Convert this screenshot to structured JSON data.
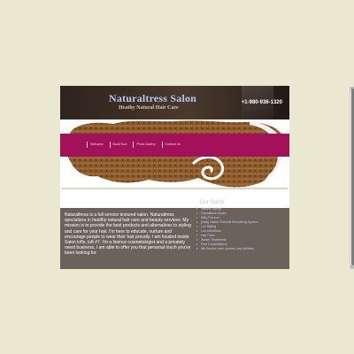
{
  "header": {
    "title": "Naturaltress Salon",
    "tagline": "Heathy Natural Hair Care",
    "phone": "+1-980-936-1320"
  },
  "nav": {
    "items": [
      {
        "label": "Welcome"
      },
      {
        "label": "Book Now"
      },
      {
        "label": "Photo Gallery"
      },
      {
        "label": "Contact Us"
      }
    ]
  },
  "intro": {
    "text": "Naturaltress is a full service textured salon. Naturaltress specializes in healthy natural hair care and beauty services. My mission is to provide the best products and alternatives to styling and care for your hair. I'm here to educate, nurture and encourage people to wear their hair proudly. I am located inside Salon lofts, loft #7. I'm a licence cosmetologist and a privately owed business, I am able to offer you that personal touch you've been looking for."
  },
  "sidebar": {
    "title": "Our Salon",
    "services": [
      {
        "label": "Natural Styling"
      },
      {
        "label": "Transitional Styles"
      },
      {
        "label": "Silky Flat Iron"
      },
      {
        "label": "(New) Naked Thermal Smoothing System"
      },
      {
        "label": "Loc Styling"
      },
      {
        "label": "Loc extentions"
      },
      {
        "label": "Hair Color"
      },
      {
        "label": "Steam Treatments"
      },
      {
        "label": "Free Consultations"
      },
      {
        "label": "We Service men, women, and children"
      }
    ]
  },
  "colors": {
    "page_background": "#ebe8d2",
    "header": "#3b2e25",
    "nav_bar": "#a3115a",
    "content_panel": "#6b635b",
    "title_text": "#b8c9ef",
    "banner_art": "#8b5a2b"
  }
}
